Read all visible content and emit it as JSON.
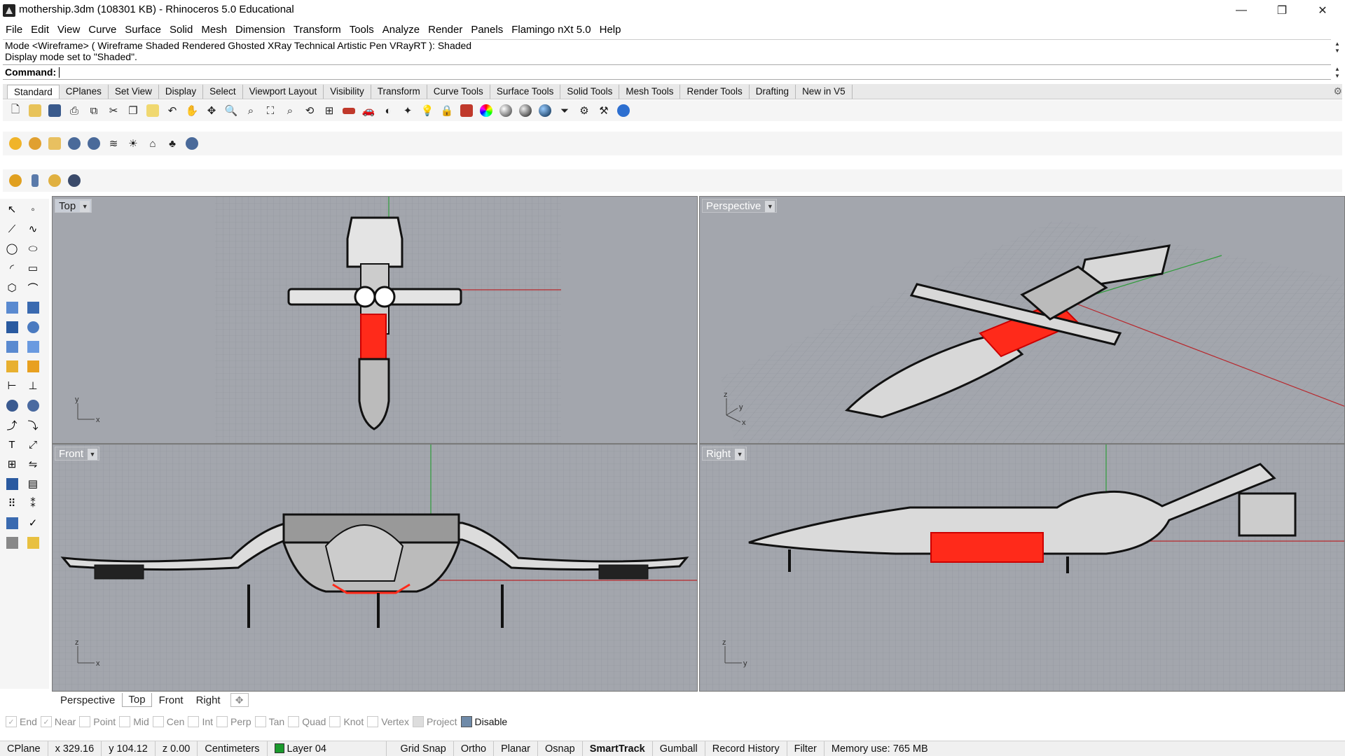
{
  "window": {
    "title": "mothership.3dm (108301 KB) - Rhinoceros 5.0 Educational",
    "minimize": "—",
    "maximize": "❐",
    "close": "✕"
  },
  "menu": [
    "File",
    "Edit",
    "View",
    "Curve",
    "Surface",
    "Solid",
    "Mesh",
    "Dimension",
    "Transform",
    "Tools",
    "Analyze",
    "Render",
    "Panels",
    "Flamingo nXt 5.0",
    "Help"
  ],
  "command": {
    "history": [
      "Mode <Wireframe> ( Wireframe  Shaded  Rendered  Ghosted  XRay  Technical  Artistic  Pen  VRayRT ): Shaded",
      "Display mode set to \"Shaded\"."
    ],
    "prompt_label": "Command:"
  },
  "toolbar_tabs": [
    "Standard",
    "CPlanes",
    "Set View",
    "Display",
    "Select",
    "Viewport Layout",
    "Visibility",
    "Transform",
    "Curve Tools",
    "Surface Tools",
    "Solid Tools",
    "Mesh Tools",
    "Render Tools",
    "Drafting",
    "New in V5"
  ],
  "toolbar_tabs_active": "Standard",
  "standard_icons": [
    "new-file",
    "open-file",
    "save",
    "print",
    "import",
    "cut",
    "copy",
    "paste",
    "undo",
    "pan",
    "rotate-view",
    "zoom-in",
    "zoom-window",
    "zoom-extents",
    "zoom-selected",
    "zoom-all",
    "viewport-4",
    "render",
    "car",
    "layer",
    "lock",
    "show-objects",
    "light",
    "lock-objects",
    "material",
    "color-wheel",
    "shade-sphere",
    "render-sphere",
    "blue-sphere",
    "filter",
    "gear",
    "option",
    "help"
  ],
  "plugin_icons_row1": [
    "maxwell-m",
    "vray-gear",
    "vray-tag",
    "render-r",
    "render-rt",
    "grass",
    "sun",
    "lamp",
    "tree",
    "help"
  ],
  "plugin_icons_row2": [
    "sun-gear",
    "bottle",
    "round-m",
    "round-br"
  ],
  "viewports": {
    "top": {
      "label": "Top",
      "axis_x": "x",
      "axis_y": "y"
    },
    "perspective": {
      "label": "Perspective",
      "axis_x": "x",
      "axis_y": "y",
      "axis_z": "z"
    },
    "front": {
      "label": "Front",
      "axis_x": "x",
      "axis_y": "z"
    },
    "right": {
      "label": "Right",
      "axis_x": "y",
      "axis_y": "z"
    }
  },
  "viewport_tabs": [
    "Perspective",
    "Top",
    "Front",
    "Right"
  ],
  "viewport_tabs_active": "Top",
  "osnap": [
    {
      "label": "End",
      "checked": true
    },
    {
      "label": "Near",
      "checked": true
    },
    {
      "label": "Point",
      "checked": false
    },
    {
      "label": "Mid",
      "checked": false
    },
    {
      "label": "Cen",
      "checked": false
    },
    {
      "label": "Int",
      "checked": false
    },
    {
      "label": "Perp",
      "checked": false
    },
    {
      "label": "Tan",
      "checked": false
    },
    {
      "label": "Quad",
      "checked": false
    },
    {
      "label": "Knot",
      "checked": false
    },
    {
      "label": "Vertex",
      "checked": false
    },
    {
      "label": "Project",
      "checked": false
    },
    {
      "label": "Disable",
      "checked": true
    }
  ],
  "status": {
    "cplane": "CPlane",
    "x": "x 329.16",
    "y": "y 104.12",
    "z": "z 0.00",
    "units": "Centimeters",
    "layer": "Layer 04",
    "layer_color": "#1a9a2c",
    "toggles": [
      "Grid Snap",
      "Ortho",
      "Planar",
      "Osnap",
      "SmartTrack",
      "Gumball",
      "Record History",
      "Filter"
    ],
    "active_toggle": "SmartTrack",
    "memory": "Memory use: 765 MB"
  },
  "colors": {
    "viewport_bg": "#a3a6ad",
    "grid": "#8f939b",
    "axis_x": "#b8262b",
    "axis_y": "#2f9c3a",
    "selection": "#ff2a1a"
  }
}
